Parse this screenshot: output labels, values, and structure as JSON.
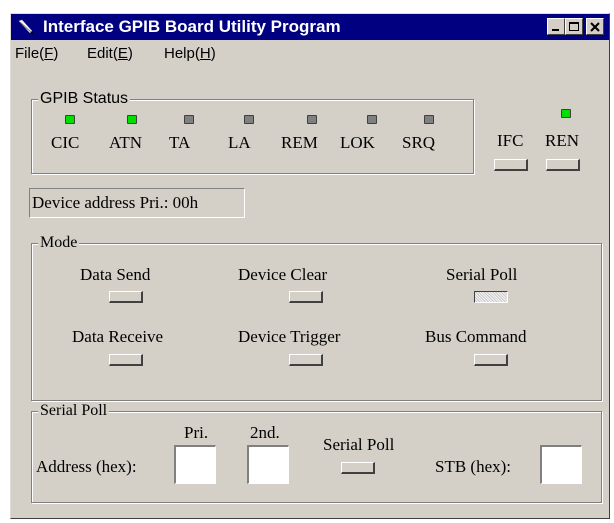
{
  "window": {
    "title": "Interface GPIB Board Utility Program"
  },
  "menu": {
    "file": {
      "label": "File(",
      "key": "F",
      "end": ")"
    },
    "edit": {
      "label": "Edit(",
      "key": "E",
      "end": ")"
    },
    "help": {
      "label": "Help(",
      "key": "H",
      "end": ")"
    }
  },
  "gpib_status": {
    "title": "GPIB Status",
    "indicators": [
      {
        "label": "CIC",
        "on": true
      },
      {
        "label": "ATN",
        "on": true
      },
      {
        "label": "TA",
        "on": false
      },
      {
        "label": "LA",
        "on": false
      },
      {
        "label": "REM",
        "on": false
      },
      {
        "label": "LOK",
        "on": false
      },
      {
        "label": "SRQ",
        "on": false
      }
    ]
  },
  "ifc": {
    "label": "IFC"
  },
  "ren": {
    "label": "REN",
    "on": true
  },
  "device_address": "Device address Pri.: 00h",
  "mode": {
    "title": "Mode",
    "buttons": [
      "Data Send",
      "Device Clear",
      "Serial Poll",
      "Data Receive",
      "Device Trigger",
      "Bus Command"
    ],
    "pressed": "Serial Poll"
  },
  "serial_poll": {
    "title": "Serial Poll",
    "address_label": "Address (hex):",
    "pri_label": "Pri.",
    "pri_value": "",
    "second_label": "2nd.",
    "second_value": "",
    "button_label": "Serial Poll",
    "stb_label": "STB (hex):",
    "stb_value": ""
  },
  "colors": {
    "titlebar": "#000080",
    "led_on": "#00e000",
    "led_off": "#808080",
    "face": "#d4d0c8"
  }
}
